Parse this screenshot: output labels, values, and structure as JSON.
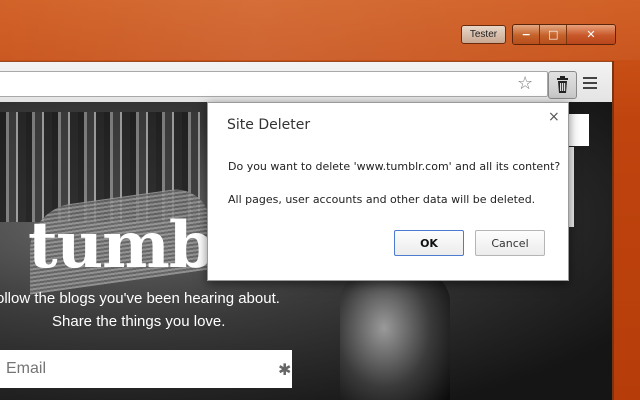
{
  "window": {
    "profile_label": "Tester",
    "min_glyph": "−",
    "max_glyph": "□",
    "close_glyph": "✕"
  },
  "toolbar": {
    "star_glyph": "☆"
  },
  "page": {
    "logo_text": "tumblr",
    "tagline_1": "ollow the blogs you've been hearing about.",
    "tagline_2": "Share the things you love.",
    "email_placeholder": "Email",
    "required_mark": "✱"
  },
  "dialog": {
    "title": "Site Deleter",
    "close_glyph": "×",
    "message": "Do you want to delete 'www.tumblr.com' and all its content?",
    "submessage": "All pages, user accounts and other data will be deleted.",
    "ok_label": "OK",
    "cancel_label": "Cancel"
  },
  "colors": {
    "frame": "#c0440e",
    "ok_border": "#4d7bd0"
  }
}
